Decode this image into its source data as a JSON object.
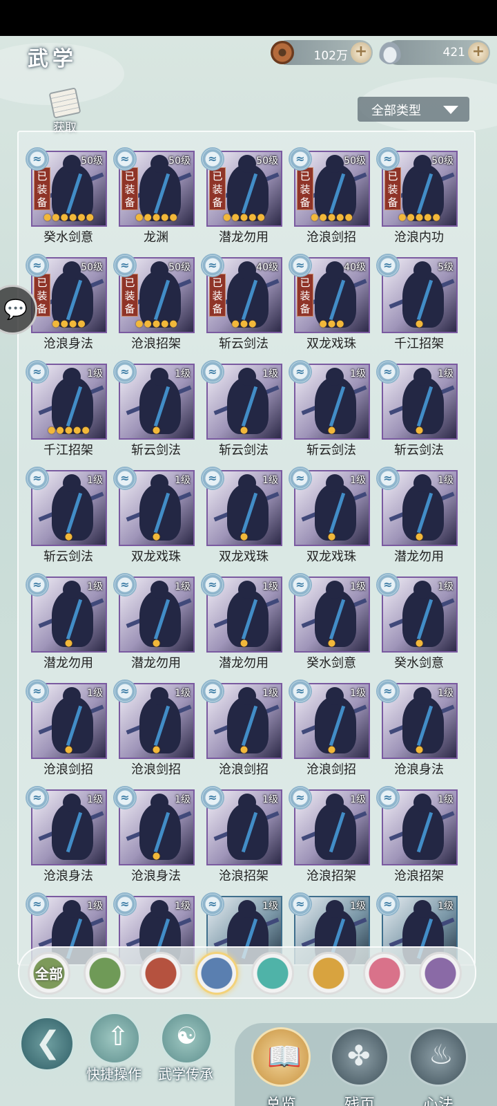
{
  "header": {
    "title": "武学",
    "copper": "102万",
    "silver": "421",
    "obtain_label": "获取",
    "filter_label": "全部类型"
  },
  "skills": [
    {
      "name": "癸水剑意",
      "level": "50级",
      "equipped": true,
      "stars": 6
    },
    {
      "name": "龙渊",
      "level": "50级",
      "equipped": true,
      "stars": 5
    },
    {
      "name": "潜龙勿用",
      "level": "50级",
      "equipped": true,
      "stars": 5
    },
    {
      "name": "沧浪剑招",
      "level": "50级",
      "equipped": true,
      "stars": 5
    },
    {
      "name": "沧浪内功",
      "level": "50级",
      "equipped": true,
      "stars": 5
    },
    {
      "name": "沧浪身法",
      "level": "50级",
      "equipped": true,
      "stars": 4
    },
    {
      "name": "沧浪招架",
      "level": "50级",
      "equipped": true,
      "stars": 5
    },
    {
      "name": "斩云剑法",
      "level": "40级",
      "equipped": true,
      "stars": 3
    },
    {
      "name": "双龙戏珠",
      "level": "40级",
      "equipped": true,
      "stars": 3
    },
    {
      "name": "千江招架",
      "level": "5级",
      "equipped": false,
      "stars": 1
    },
    {
      "name": "千江招架",
      "level": "1级",
      "equipped": false,
      "stars": 5
    },
    {
      "name": "斩云剑法",
      "level": "1级",
      "equipped": false,
      "stars": 1
    },
    {
      "name": "斩云剑法",
      "level": "1级",
      "equipped": false,
      "stars": 1
    },
    {
      "name": "斩云剑法",
      "level": "1级",
      "equipped": false,
      "stars": 1
    },
    {
      "name": "斩云剑法",
      "level": "1级",
      "equipped": false,
      "stars": 1
    },
    {
      "name": "斩云剑法",
      "level": "1级",
      "equipped": false,
      "stars": 1
    },
    {
      "name": "双龙戏珠",
      "level": "1级",
      "equipped": false,
      "stars": 1
    },
    {
      "name": "双龙戏珠",
      "level": "1级",
      "equipped": false,
      "stars": 1
    },
    {
      "name": "双龙戏珠",
      "level": "1级",
      "equipped": false,
      "stars": 1
    },
    {
      "name": "潜龙勿用",
      "level": "1级",
      "equipped": false,
      "stars": 1
    },
    {
      "name": "潜龙勿用",
      "level": "1级",
      "equipped": false,
      "stars": 1
    },
    {
      "name": "潜龙勿用",
      "level": "1级",
      "equipped": false,
      "stars": 1
    },
    {
      "name": "潜龙勿用",
      "level": "1级",
      "equipped": false,
      "stars": 1
    },
    {
      "name": "癸水剑意",
      "level": "1级",
      "equipped": false,
      "stars": 1
    },
    {
      "name": "癸水剑意",
      "level": "1级",
      "equipped": false,
      "stars": 1
    },
    {
      "name": "沧浪剑招",
      "level": "1级",
      "equipped": false,
      "stars": 1
    },
    {
      "name": "沧浪剑招",
      "level": "1级",
      "equipped": false,
      "stars": 1
    },
    {
      "name": "沧浪剑招",
      "level": "1级",
      "equipped": false,
      "stars": 1
    },
    {
      "name": "沧浪剑招",
      "level": "1级",
      "equipped": false,
      "stars": 1
    },
    {
      "name": "沧浪身法",
      "level": "1级",
      "equipped": false,
      "stars": 1
    },
    {
      "name": "沧浪身法",
      "level": "1级",
      "equipped": false,
      "stars": 0
    },
    {
      "name": "沧浪身法",
      "level": "1级",
      "equipped": false,
      "stars": 1
    },
    {
      "name": "沧浪招架",
      "level": "1级",
      "equipped": false,
      "stars": 0
    },
    {
      "name": "沧浪招架",
      "level": "1级",
      "equipped": false,
      "stars": 0
    },
    {
      "name": "沧浪招架",
      "level": "1级",
      "equipped": false,
      "stars": 0
    },
    {
      "name": "",
      "level": "1级",
      "equipped": false,
      "stars": 0
    },
    {
      "name": "",
      "level": "1级",
      "equipped": false,
      "stars": 0
    },
    {
      "name": "",
      "level": "1级",
      "equipped": false,
      "stars": 0
    },
    {
      "name": "",
      "level": "1级",
      "equipped": false,
      "stars": 0
    },
    {
      "name": "",
      "level": "1级",
      "equipped": false,
      "stars": 0
    }
  ],
  "equipped_text": "已装备",
  "school_filters": [
    {
      "label": "全部",
      "color": "#7d9a5a",
      "icon": "all-school-icon",
      "selected": false
    },
    {
      "label": "",
      "color": "#6f9a57",
      "icon": "sword-school-icon",
      "selected": false
    },
    {
      "label": "",
      "color": "#b5523f",
      "icon": "flame-school-icon",
      "selected": false
    },
    {
      "label": "",
      "color": "#5a7fb0",
      "icon": "wave-school-icon",
      "selected": true
    },
    {
      "label": "",
      "color": "#4fb3a8",
      "icon": "butterfly-school-icon",
      "selected": false
    },
    {
      "label": "",
      "color": "#d8a33f",
      "icon": "shield-school-icon",
      "selected": false
    },
    {
      "label": "",
      "color": "#d9728a",
      "icon": "moon-school-icon",
      "selected": false
    },
    {
      "label": "",
      "color": "#8a6aa6",
      "icon": "flower-school-icon",
      "selected": false
    }
  ],
  "bottom_nav": {
    "quick_ops": "快捷操作",
    "inheritance": "武学传承",
    "tabs": [
      {
        "label": "总览",
        "icon": "book-icon",
        "active": true
      },
      {
        "label": "残页",
        "icon": "puzzle-icon",
        "active": false
      },
      {
        "label": "心法",
        "icon": "spirit-flame-icon",
        "active": false
      }
    ]
  }
}
